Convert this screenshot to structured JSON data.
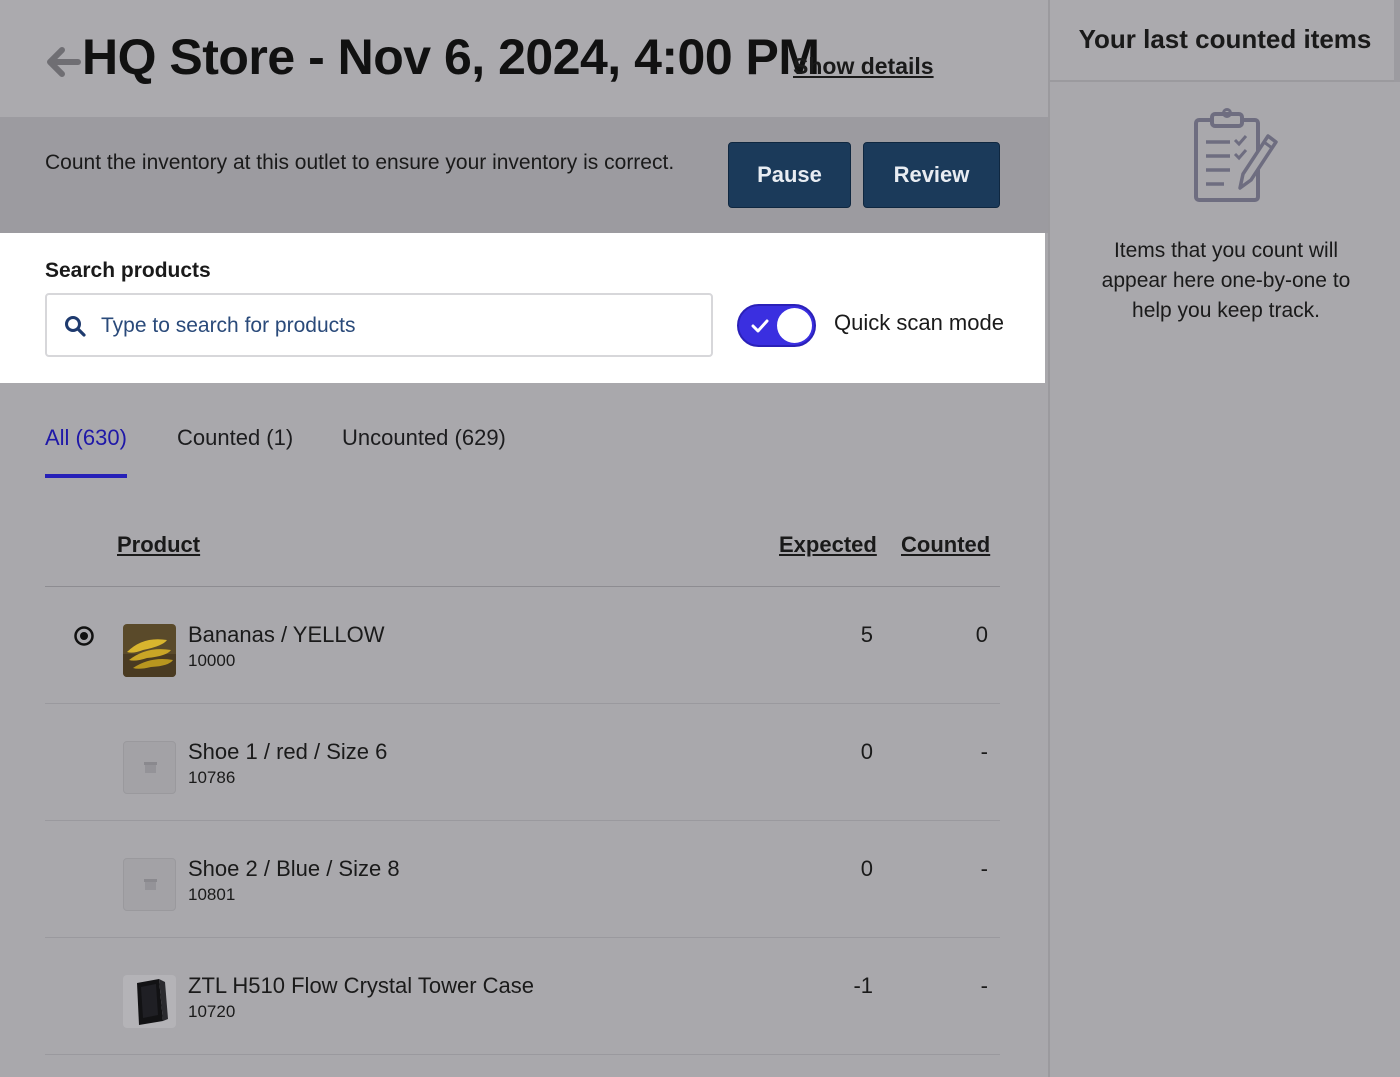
{
  "header": {
    "title": "HQ Store - Nov 6, 2024, 4:00 PM",
    "show_details": "Show details"
  },
  "banner": {
    "text": "Count the inventory at this outlet to ensure your inventory is correct.",
    "pause_label": "Pause",
    "review_label": "Review"
  },
  "search": {
    "label": "Search products",
    "placeholder": "Type to search for products",
    "quick_scan_label": "Quick scan mode",
    "quick_scan_enabled": true
  },
  "tabs": [
    {
      "label": "All (630)",
      "active": true
    },
    {
      "label": "Counted (1)",
      "active": false
    },
    {
      "label": "Uncounted (629)",
      "active": false
    }
  ],
  "table": {
    "columns": {
      "product": "Product",
      "expected": "Expected",
      "counted": "Counted"
    },
    "rows": [
      {
        "name": "Bananas / YELLOW",
        "sku": "10000",
        "expected": "5",
        "counted": "0",
        "thumb": "bananas-image",
        "selected": true
      },
      {
        "name": "Shoe 1 / red / Size 6",
        "sku": "10786",
        "expected": "0",
        "counted": "-",
        "thumb": "placeholder-image",
        "selected": false
      },
      {
        "name": "Shoe 2 / Blue / Size 8",
        "sku": "10801",
        "expected": "0",
        "counted": "-",
        "thumb": "placeholder-image",
        "selected": false
      },
      {
        "name": "ZTL H510 Flow Crystal Tower Case",
        "sku": "10720",
        "expected": "-1",
        "counted": "-",
        "thumb": "tower-case-image",
        "selected": false
      }
    ]
  },
  "sidebar": {
    "title": "Your last counted items",
    "empty_text": "Items that you count will appear here one-by-one to help you keep track.",
    "icon": "clipboard-check-icon"
  },
  "colors": {
    "primary_button": "#1b3a5a",
    "toggle_on": "#3a2fe0",
    "active_tab": "#2620b8"
  }
}
